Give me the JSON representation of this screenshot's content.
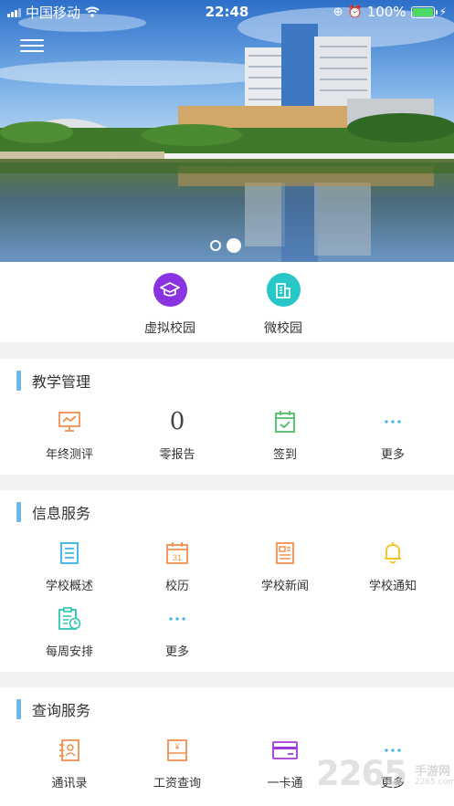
{
  "status_bar": {
    "carrier": "中国移动",
    "time": "22:48",
    "battery": "100%"
  },
  "banner": {
    "slide_count": 2,
    "active_slide": 2
  },
  "quick_links": [
    {
      "label": "虚拟校园",
      "icon": "graduation-cap-icon",
      "color": "#8a33e0"
    },
    {
      "label": "微校园",
      "icon": "building-icon",
      "color": "#27c7c7"
    }
  ],
  "sections": {
    "teaching": {
      "title": "教学管理",
      "items": [
        {
          "label": "年终测评",
          "icon": "presentation-chart-icon"
        },
        {
          "label": "零报告",
          "value": "0"
        },
        {
          "label": "签到",
          "icon": "calendar-check-icon"
        },
        {
          "label": "更多",
          "icon": "more-dots-icon"
        }
      ]
    },
    "info": {
      "title": "信息服务",
      "items": [
        {
          "label": "学校概述",
          "icon": "document-list-icon"
        },
        {
          "label": "校历",
          "icon": "calendar-icon",
          "value": "31"
        },
        {
          "label": "学校新闻",
          "icon": "newspaper-icon"
        },
        {
          "label": "学校通知",
          "icon": "bell-icon"
        },
        {
          "label": "每周安排",
          "icon": "clipboard-clock-icon"
        },
        {
          "label": "更多",
          "icon": "more-dots-icon"
        }
      ]
    },
    "query": {
      "title": "查询服务",
      "items": [
        {
          "label": "通讯录",
          "icon": "contacts-icon"
        },
        {
          "label": "工资查询",
          "icon": "salary-icon",
          "value": "¥"
        },
        {
          "label": "一卡通",
          "icon": "card-icon"
        },
        {
          "label": "更多",
          "icon": "more-dots-icon"
        }
      ]
    }
  },
  "watermark": {
    "brand": "2265",
    "site_name": "手游网",
    "site": "2265.com"
  },
  "colors": {
    "accent_bar": "#6cb7e6",
    "orange": "#f0904f",
    "green": "#4cbf6a",
    "blue": "#3bb1e6",
    "yellow": "#f5c11e",
    "purple": "#a03ad6"
  }
}
